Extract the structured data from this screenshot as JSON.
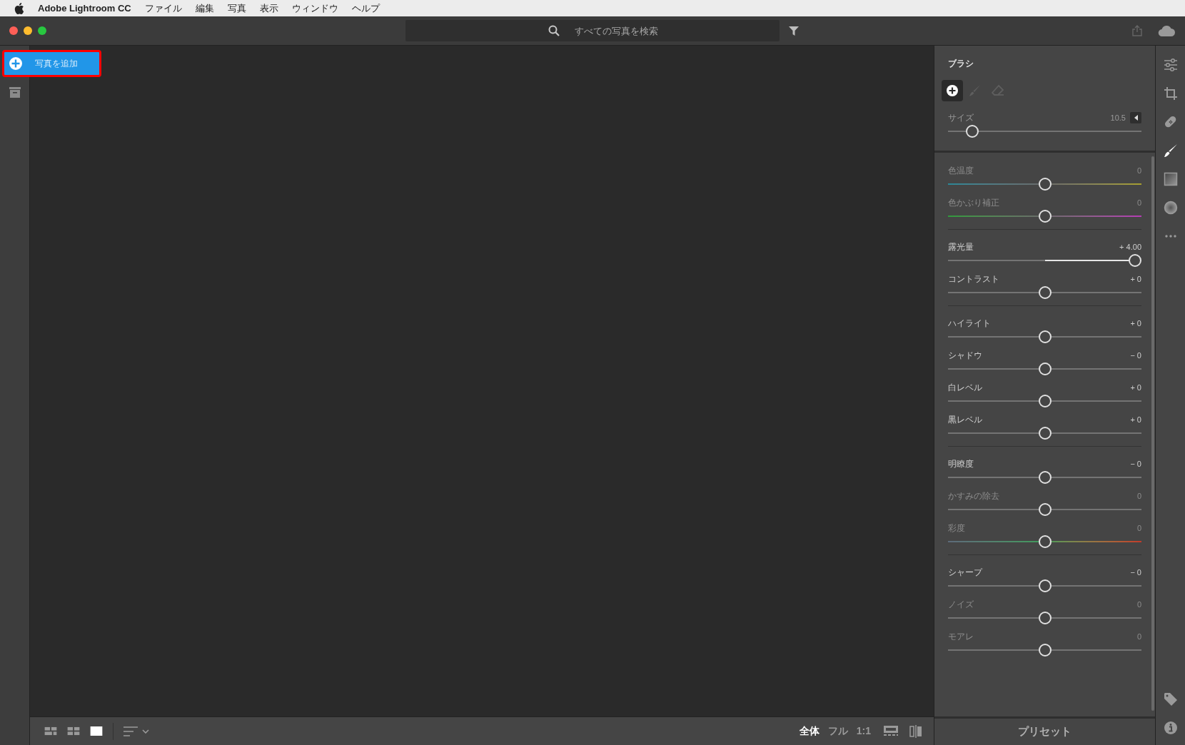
{
  "menu_bar": {
    "app_name": "Adobe Lightroom CC",
    "items": [
      "ファイル",
      "編集",
      "写真",
      "表示",
      "ウィンドウ",
      "ヘルプ"
    ]
  },
  "toolbar": {
    "search": {
      "placeholder": "すべての写真を検索"
    }
  },
  "left_rail": {
    "add_photos_button": "写真を追加"
  },
  "bottom_bar": {
    "view_modes": [
      {
        "kind": "mosaic",
        "selected": false
      },
      {
        "kind": "grid",
        "selected": false
      },
      {
        "kind": "single",
        "selected": true
      }
    ],
    "zoom_options": [
      {
        "label": "全体",
        "selected": true
      },
      {
        "label": "フル",
        "selected": false
      },
      {
        "label": "1:1",
        "selected": false
      }
    ]
  },
  "brush_panel": {
    "title": "ブラシ",
    "tools": [
      {
        "kind": "add",
        "selected": true
      },
      {
        "kind": "brush",
        "selected": false
      },
      {
        "kind": "eraser",
        "selected": false
      }
    ],
    "size": {
      "label": "サイズ",
      "value": "10.5",
      "level": 0.1
    },
    "groups": [
      {
        "sliders": [
          {
            "label": "色温度",
            "value": "0",
            "level": 0.5,
            "kind": "temperature",
            "disabled": true
          },
          {
            "label": "色かぶり補正",
            "value": "0",
            "level": 0.5,
            "kind": "tint",
            "disabled": true
          }
        ]
      },
      {
        "sliders": [
          {
            "label": "露光量",
            "value": "+ 4.00",
            "level": 1,
            "kind": "plain",
            "disabled": false
          },
          {
            "label": "コントラスト",
            "value": "+ 0",
            "level": 0.5,
            "kind": "plain",
            "disabled": false
          }
        ]
      },
      {
        "sliders": [
          {
            "label": "ハイライト",
            "value": "+ 0",
            "level": 0.5,
            "kind": "plain",
            "disabled": false
          },
          {
            "label": "シャドウ",
            "value": "− 0",
            "level": 0.5,
            "kind": "plain",
            "disabled": false
          },
          {
            "label": "白レベル",
            "value": "+ 0",
            "level": 0.5,
            "kind": "plain",
            "disabled": false
          },
          {
            "label": "黒レベル",
            "value": "+ 0",
            "level": 0.5,
            "kind": "plain",
            "disabled": false
          }
        ]
      },
      {
        "sliders": [
          {
            "label": "明瞭度",
            "value": "− 0",
            "level": 0.5,
            "kind": "plain",
            "disabled": false
          },
          {
            "label": "かすみの除去",
            "value": "0",
            "level": 0.5,
            "kind": "plain",
            "disabled": true
          },
          {
            "label": "彩度",
            "value": "0",
            "level": 0.5,
            "kind": "saturation",
            "disabled": true
          }
        ]
      },
      {
        "sliders": [
          {
            "label": "シャープ",
            "value": "− 0",
            "level": 0.5,
            "kind": "plain",
            "disabled": false
          },
          {
            "label": "ノイズ",
            "value": "0",
            "level": 0.5,
            "kind": "plain",
            "disabled": true
          },
          {
            "label": "モアレ",
            "value": "0",
            "level": 0.5,
            "kind": "plain",
            "disabled": true
          }
        ]
      }
    ],
    "presets_button": "プリセット"
  },
  "tool_rail": [
    {
      "kind": "edit",
      "selected": false
    },
    {
      "kind": "crop",
      "selected": false
    },
    {
      "kind": "heal",
      "selected": false
    },
    {
      "kind": "brush",
      "selected": true
    },
    {
      "kind": "linear",
      "selected": false
    },
    {
      "kind": "radial",
      "selected": false
    },
    {
      "kind": "more",
      "selected": false
    },
    {
      "kind": "keywords",
      "selected": false
    },
    {
      "kind": "info",
      "selected": false
    }
  ]
}
